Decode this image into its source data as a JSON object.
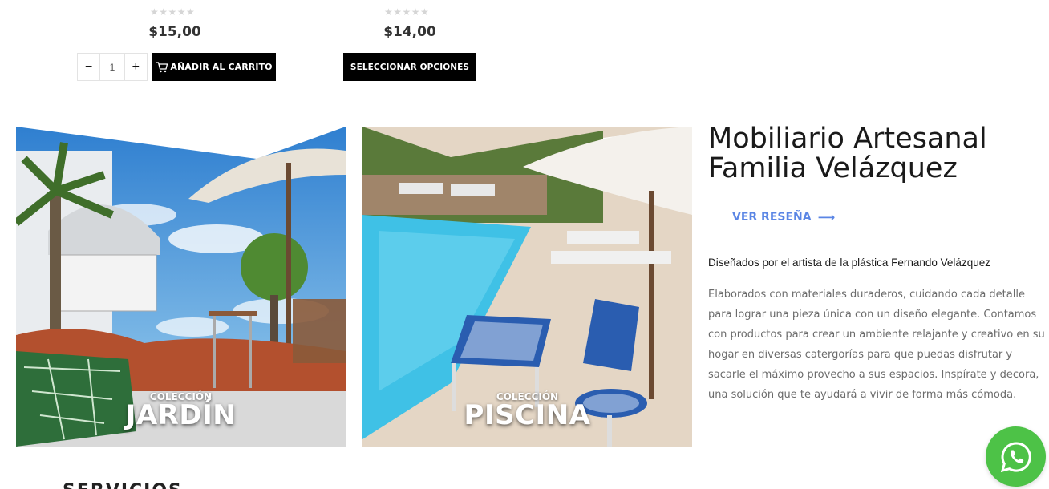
{
  "products": [
    {
      "rating_text": "★★★★★",
      "price": "$15,00",
      "qty_minus": "−",
      "qty_value": "1",
      "qty_plus": "+",
      "button_label": "AÑADIR AL CARRITO"
    },
    {
      "rating_text": "★★★★★",
      "price": "$14,00",
      "button_label": "SELECCIONAR OPCIONES"
    }
  ],
  "collections": [
    {
      "subtitle": "COLECCIÓN",
      "title": "JARDÍN"
    },
    {
      "subtitle": "COLECCIÓN",
      "title": "PISCINA"
    }
  ],
  "info": {
    "heading": "Mobiliario Artesanal Familia Velázquez",
    "review_link": "VER RESEÑA",
    "subtitle": "Diseñados por el artista de la plástica Fernando Velázquez",
    "description": "Elaborados con materiales duraderos, cuidando cada detalle para lograr una pieza única con un diseño elegante. Contamos con productos para crear un ambiente relajante y creativo en su hogar en diversas catergorías para que puedas disfrutar y sacarle el máximo provecho a sus espacios. Inspírate y decora, una solución que te ayudará a vivir de forma más cómoda."
  },
  "partial_section_title": "SERVICIOS",
  "colors": {
    "accent": "#5b86e5",
    "whatsapp": "#4dc247",
    "button": "#000000"
  },
  "icons": [
    "star-icon",
    "cart-icon",
    "arrow-right-icon",
    "whatsapp-icon"
  ]
}
